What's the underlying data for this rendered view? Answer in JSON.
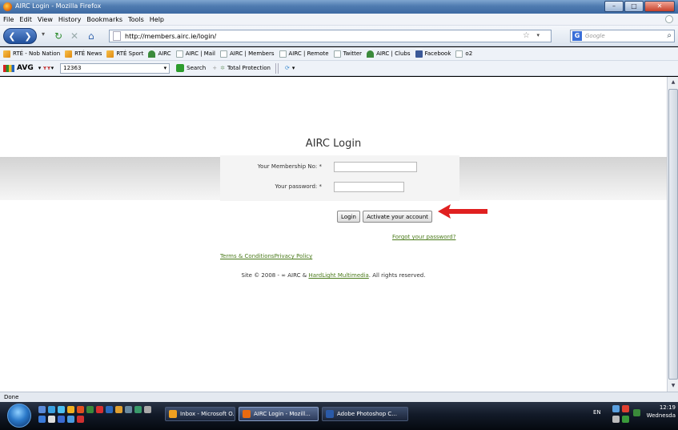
{
  "window": {
    "title": "AIRC Login - Mozilla Firefox",
    "minimize_label": "–",
    "maximize_label": "□",
    "close_label": "✕"
  },
  "menu": [
    "File",
    "Edit",
    "View",
    "History",
    "Bookmarks",
    "Tools",
    "Help"
  ],
  "nav": {
    "url": "http://members.airc.ie/login/",
    "search_placeholder": "Google",
    "search_engine_letter": "G"
  },
  "bookmarks": [
    {
      "label": "RTÉ - Nob Nation",
      "icon": "rte"
    },
    {
      "label": "RTÉ News",
      "icon": "rte"
    },
    {
      "label": "RTÉ Sport",
      "icon": "rte"
    },
    {
      "label": "AIRC",
      "icon": "airc"
    },
    {
      "label": "AIRC | Mail",
      "icon": "page"
    },
    {
      "label": "AIRC | Members",
      "icon": "page"
    },
    {
      "label": "AIRC | Remote",
      "icon": "page"
    },
    {
      "label": "Twitter",
      "icon": "page"
    },
    {
      "label": "AIRC | Clubs",
      "icon": "airc"
    },
    {
      "label": "Facebook",
      "icon": "fb"
    },
    {
      "label": "o2",
      "icon": "page"
    }
  ],
  "avg_toolbar": {
    "logo": "AVG",
    "input_value": "12363",
    "search_label": "Search",
    "protection_label": "Total Protection"
  },
  "page": {
    "title": "AIRC Login",
    "membership_label": "Your Membership No: *",
    "membership_value": "",
    "password_label": "Your password: *",
    "password_value": "",
    "login_button": "Login",
    "activate_button": "Activate your account",
    "forgot_link": "Forgot your password?",
    "terms_link": "Terms & ConditionsPrivacy Policy",
    "footer_prefix": "Site © 2008 - ∞ AIRC & ",
    "footer_link": "HardLight Multimedia",
    "footer_suffix": ". All rights reserved."
  },
  "annotation": {
    "arrow_color": "#e02020"
  },
  "status": {
    "text": "Done"
  },
  "taskbar": {
    "tasks": [
      {
        "label": "Inbox - Microsoft O...",
        "icon_color": "#f0a020",
        "active": false
      },
      {
        "label": "AIRC Login - Mozill...",
        "icon_color": "#e86a10",
        "active": true
      },
      {
        "label": "Adobe Photoshop C...",
        "icon_color": "#2a5aa8",
        "active": false
      }
    ],
    "language": "EN",
    "time": "12:19",
    "day": "Wednesda"
  }
}
